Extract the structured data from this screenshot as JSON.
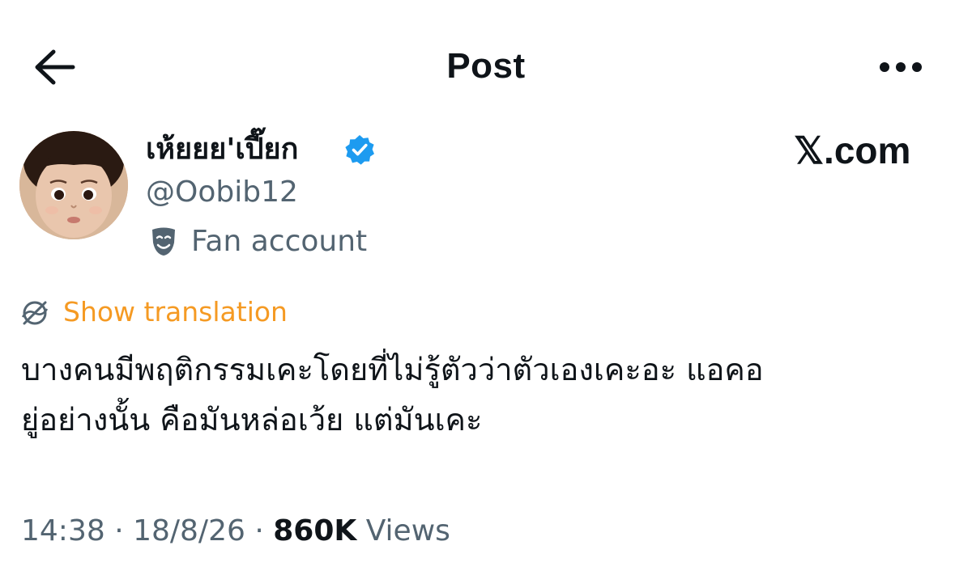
{
  "header": {
    "title": "Post",
    "back_icon": "arrow-left-icon",
    "more_icon": "more-horizontal-icon"
  },
  "author": {
    "display_name": "เห้ยยย'เปี๊ยก",
    "handle": "@Oobib12",
    "verified": true,
    "verified_color": "#1d9bf0",
    "label_icon": "theater-mask-icon",
    "label": "Fan account"
  },
  "watermark": {
    "text": "𝕏.com"
  },
  "translation": {
    "icon": "translate-globe-icon",
    "label": "Show translation",
    "color": "#f59a23"
  },
  "post": {
    "text": "บางคนมีพฤติกรรมเคะโดยที่ไม่รู้ตัวว่าตัวเองเคะอะ แอคอ\nยู่อย่างนั้น คือมันหล่อเว้ย แต่มันเคะ"
  },
  "meta": {
    "time": "14:38",
    "separator": " · ",
    "date": "18/8/26",
    "views_count": "860K",
    "views_label": "Views"
  }
}
